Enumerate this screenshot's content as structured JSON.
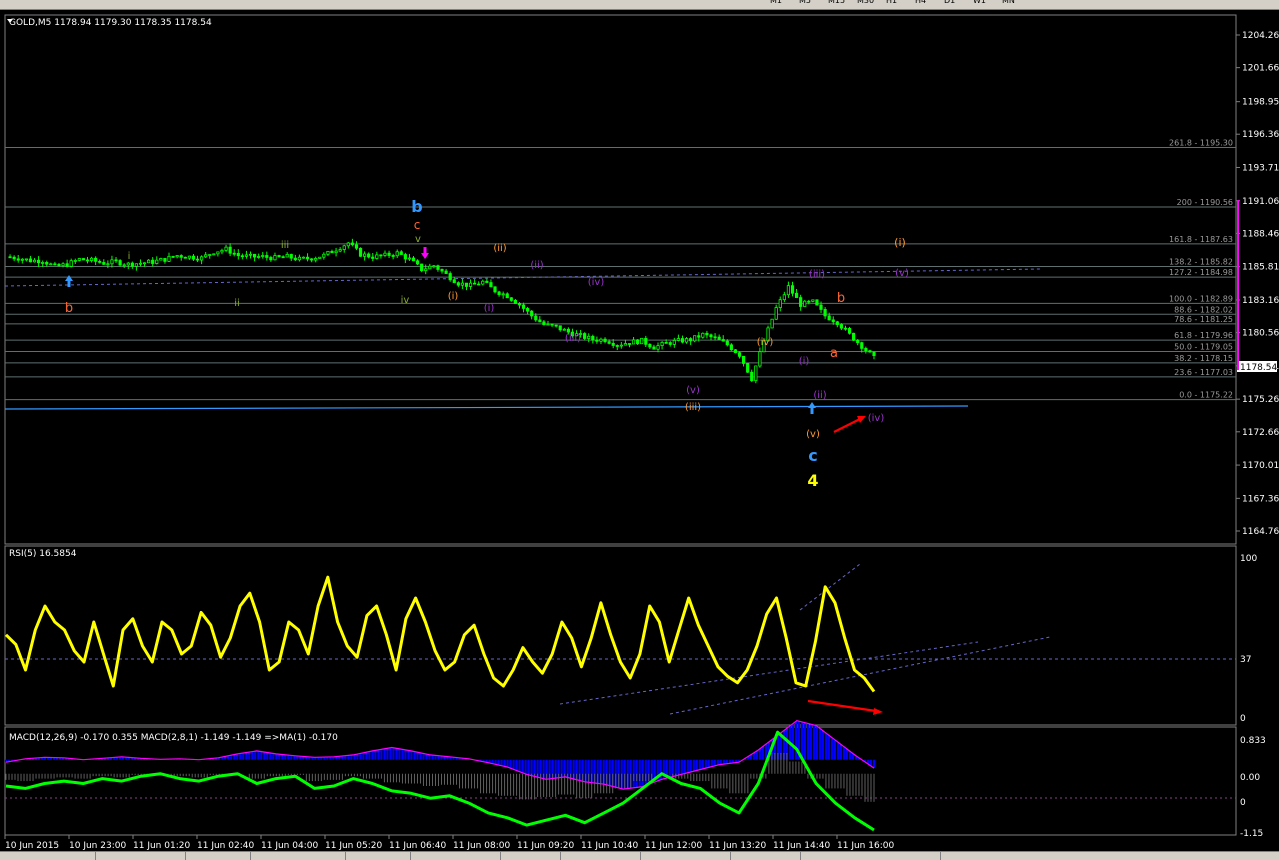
{
  "toolbar": {
    "timeframes": [
      "M1",
      "M5",
      "M15",
      "M30",
      "H1",
      "H4",
      "D1",
      "W1",
      "MN"
    ],
    "active_timeframe": "M5"
  },
  "chart_header": {
    "symbol": "GOLD,M5",
    "ohlc": "1178.94 1179.30 1178.35 1178.54"
  },
  "rsi_header": "RSI(5) 16.5854",
  "macd_header": "MACD(12,26,9) -0.170 0.355  MACD(2,8,1) -1.149 -1.149  =>MA(1) -0.170",
  "price_axis": {
    "labels": [
      "1204.26",
      "1201.66",
      "1198.95",
      "1196.36",
      "1193.71",
      "1191.06",
      "1188.46",
      "1185.81",
      "1183.16",
      "1180.56",
      "1177.91",
      "1175.26",
      "1172.66",
      "1170.01",
      "1167.36",
      "1164.76"
    ],
    "current_price": "1178.54"
  },
  "rsi_axis": {
    "labels": [
      "100",
      "37",
      "0"
    ]
  },
  "macd_axis": {
    "labels": [
      "0.833",
      "0.00",
      "0",
      "-1.15"
    ]
  },
  "time_axis": [
    "10 Jun 2015",
    "10 Jun 23:00",
    "11 Jun 01:20",
    "11 Jun 02:40",
    "11 Jun 04:00",
    "11 Jun 05:20",
    "11 Jun 06:40",
    "11 Jun 08:00",
    "11 Jun 09:20",
    "11 Jun 10:40",
    "11 Jun 12:00",
    "11 Jun 13:20",
    "11 Jun 14:40",
    "11 Jun 16:00"
  ],
  "fib_levels": [
    "261.8 - 1195.30",
    "200 - 1190.56",
    "161.8 - 1187.63",
    "138.2 - 1185.82",
    "127.2 - 1184.98",
    "100.0 - 1182.89",
    "88.6 - 1182.02",
    "78.6 - 1181.25",
    "61.8 - 1179.96",
    "50.0 - 1179.05",
    "38.2 - 1178.15",
    "23.6 - 1177.03",
    "0.0 - 1175.22"
  ],
  "wave_labels": [
    "b",
    "i",
    "ii",
    "iii",
    "iv",
    "v",
    "b",
    "c",
    "(i)",
    "(ii)",
    "(i)",
    "(ii)",
    "(iii)",
    "(iv)",
    "(v)",
    "(iii)",
    "(iv)",
    "(i)",
    "(ii)",
    "(iii)",
    "(v)",
    "c",
    "4",
    "a",
    "b",
    "(i)",
    "(v)",
    "(iv)"
  ],
  "colors": {
    "background": "#000000",
    "candles": "#00ff00",
    "rsi": "#ffff00",
    "macd_histogram": "#0000ff",
    "macd_signal": "#ff00ff",
    "macd_fast": "#00ff00",
    "trend_dotted": "#6666cc",
    "support_line": "#3399ff",
    "fib_line": "#5f6f6f",
    "annotation_arrow": "#ff0000"
  },
  "chart_data": {
    "type": "candlestick",
    "symbol": "GOLD",
    "timeframe": "M5",
    "x": [
      "10 Jun 2015",
      "10 Jun 23:00",
      "11 Jun 01:20",
      "11 Jun 02:40",
      "11 Jun 04:00",
      "11 Jun 05:20",
      "11 Jun 06:40",
      "11 Jun 08:00",
      "11 Jun 09:20",
      "11 Jun 10:40",
      "11 Jun 12:00",
      "11 Jun 13:20",
      "11 Jun 14:40",
      "11 Jun 16:00"
    ],
    "ylim": [
      1164.76,
      1204.26
    ],
    "close_series": [
      1186.6,
      1186.5,
      1186.3,
      1186.3,
      1185.8,
      1186.0,
      1186.4,
      1186.3,
      1186.1,
      1186.2,
      1186.0,
      1186.1,
      1186.2,
      1186.4,
      1186.7,
      1186.6,
      1186.5,
      1187.0,
      1187.2,
      1186.7,
      1186.6,
      1186.6,
      1186.5,
      1186.6,
      1186.4,
      1186.5,
      1186.7,
      1187.2,
      1187.7,
      1186.8,
      1186.6,
      1186.7,
      1186.9,
      1186.4,
      1185.6,
      1185.9,
      1185.2,
      1184.5,
      1184.3,
      1184.6,
      1183.9,
      1183.5,
      1182.8,
      1181.9,
      1181.2,
      1181.0,
      1180.6,
      1180.3,
      1180.0,
      1180.0,
      1179.6,
      1179.8,
      1179.9,
      1179.4,
      1179.7,
      1179.9,
      1180.0,
      1180.4,
      1180.1,
      1179.6,
      1178.8,
      1176.9,
      1179.9,
      1182.5,
      1184.2,
      1182.8,
      1183.0,
      1181.9,
      1181.4,
      1180.4,
      1179.5,
      1178.54
    ],
    "rsi": {
      "name": "RSI(5)",
      "last": 16.5854,
      "level": 37,
      "ylim": [
        0,
        100
      ],
      "values": [
        52,
        46,
        30,
        55,
        70,
        60,
        55,
        42,
        35,
        60,
        40,
        20,
        55,
        62,
        45,
        35,
        60,
        55,
        40,
        45,
        66,
        58,
        38,
        50,
        70,
        78,
        60,
        30,
        35,
        60,
        55,
        40,
        70,
        88,
        60,
        45,
        38,
        64,
        70,
        52,
        30,
        62,
        75,
        60,
        42,
        30,
        35,
        52,
        58,
        40,
        25,
        20,
        30,
        44,
        35,
        28,
        40,
        60,
        50,
        32,
        50,
        72,
        52,
        35,
        25,
        40,
        70,
        60,
        35,
        55,
        75,
        58,
        45,
        32,
        26,
        22,
        30,
        45,
        65,
        75,
        50,
        22,
        20,
        48,
        82,
        72,
        50,
        30,
        25,
        16.59
      ]
    },
    "macd_histogram": {
      "name": "MACD(12,26,9)",
      "main": -0.17,
      "signal": 0.355,
      "ylim": [
        -1.15,
        0.833
      ],
      "values": [
        -0.05,
        0.02,
        0.05,
        0.04,
        0.0,
        0.03,
        0.06,
        0.03,
        0.01,
        0.02,
        0.0,
        0.04,
        0.12,
        0.18,
        0.12,
        0.08,
        0.05,
        0.06,
        0.1,
        0.18,
        0.25,
        0.18,
        0.1,
        0.06,
        0.02,
        -0.06,
        -0.15,
        -0.3,
        -0.4,
        -0.35,
        -0.45,
        -0.5,
        -0.6,
        -0.55,
        -0.4,
        -0.3,
        -0.2,
        -0.1,
        -0.05,
        0.2,
        0.5,
        0.8,
        0.7,
        0.4,
        0.1,
        -0.17
      ]
    },
    "macd_fast": {
      "name": "MACD(2,8,1)",
      "value": -1.149,
      "values": [
        -0.25,
        -0.3,
        -0.2,
        -0.15,
        -0.2,
        -0.1,
        -0.15,
        -0.05,
        0.0,
        -0.1,
        -0.15,
        -0.05,
        0.0,
        -0.2,
        -0.1,
        -0.05,
        -0.3,
        -0.25,
        -0.1,
        -0.2,
        -0.35,
        -0.4,
        -0.5,
        -0.45,
        -0.6,
        -0.8,
        -0.9,
        -1.05,
        -0.95,
        -0.85,
        -1.0,
        -0.8,
        -0.6,
        -0.3,
        0.0,
        -0.2,
        -0.3,
        -0.6,
        -0.8,
        -0.2,
        0.85,
        0.5,
        -0.2,
        -0.6,
        -0.9,
        -1.149
      ]
    },
    "rsi_level": 37
  }
}
